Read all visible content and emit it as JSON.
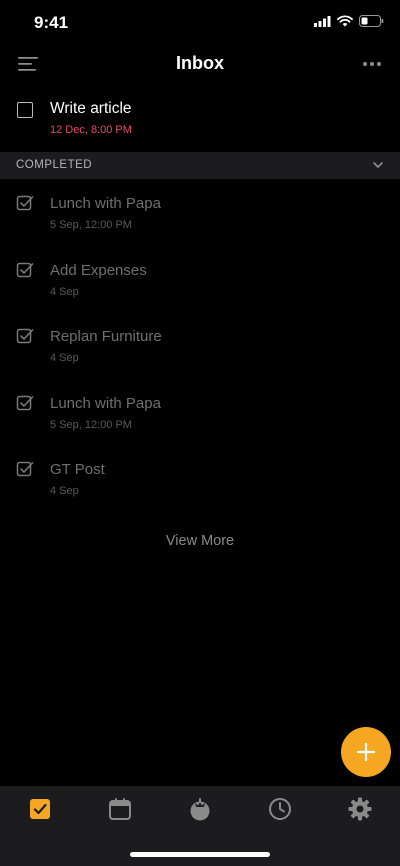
{
  "status_bar": {
    "time": "9:41"
  },
  "header": {
    "title": "Inbox"
  },
  "active_task": {
    "title": "Write article",
    "due": "12 Dec, 8:00 PM"
  },
  "completed_section": {
    "label": "COMPLETED",
    "items": [
      {
        "title": "Lunch with Papa",
        "date": "5 Sep, 12:00 PM"
      },
      {
        "title": "Add Expenses",
        "date": "4 Sep"
      },
      {
        "title": "Replan Furniture",
        "date": "4 Sep"
      },
      {
        "title": "Lunch with Papa",
        "date": "5 Sep, 12:00 PM"
      },
      {
        "title": "GT Post",
        "date": "4 Sep"
      }
    ]
  },
  "view_more_label": "View More",
  "tabs": [
    {
      "icon": "checkbox-icon",
      "active": true
    },
    {
      "icon": "calendar-icon",
      "active": false
    },
    {
      "icon": "pomodoro-icon",
      "active": false
    },
    {
      "icon": "clock-icon",
      "active": false
    },
    {
      "icon": "gear-icon",
      "active": false
    }
  ],
  "colors": {
    "accent": "#f5a623",
    "due_date": "#e94a67",
    "background": "#000000",
    "surface": "#1c1c1e"
  }
}
